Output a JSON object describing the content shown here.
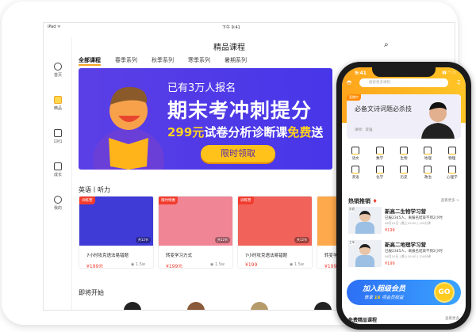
{
  "ipad": {
    "status_left": "iPad ᯤ",
    "status_time": "下午 9:41",
    "title": "精品课程",
    "sidebar": [
      {
        "label": "首页",
        "icon": "home-icon"
      },
      {
        "label": "精品",
        "icon": "diamond-icon"
      },
      {
        "label": "1对1",
        "icon": "one-on-one-icon"
      },
      {
        "label": "成长",
        "icon": "layers-icon"
      },
      {
        "label": "我的",
        "icon": "user-icon"
      }
    ],
    "tabs": [
      "全部课程",
      "春季系列",
      "秋季系列",
      "寒季系列",
      "暑期系列"
    ],
    "banner": {
      "line1": "已有3万人报名",
      "headline": "期末考冲刺提分",
      "sub_price": "299元",
      "sub_mid": "试卷分析诊断课",
      "sub_free": "免费",
      "sub_end": "送",
      "button": "限时领取"
    },
    "section1": "英语丨听力",
    "cards": [
      {
        "tag": "训练营",
        "count": "共12节",
        "title": "7小时攻克语法易错题",
        "price": "¥199元",
        "views": "1.5w",
        "color": "#3f3bd6"
      },
      {
        "tag": "限时特惠",
        "count": "共12节",
        "title": "转变学习方式",
        "price": "¥199元",
        "views": "1.5w",
        "color": "#f08595"
      },
      {
        "tag": "训练营",
        "count": "共12节",
        "title": "7小时攻克语法易错题",
        "price": "¥199",
        "views": "1.5w",
        "color": "#f0625a"
      },
      {
        "tag": "",
        "count": "",
        "title": "转变学习方式",
        "price": "¥199元",
        "views": "",
        "color": "#ffa94d"
      }
    ],
    "section2": "即将开始"
  },
  "phone": {
    "time": "9:41",
    "search_placeholder": "搜索更多课程",
    "banner": {
      "tag": "直播中",
      "title": "必备文诗词题必杀技",
      "teacher": "讲师：李强"
    },
    "subjects": [
      "语文",
      "数学",
      "生物",
      "地理",
      "物理",
      "英语",
      "化学",
      "历史",
      "政治",
      "心理学"
    ],
    "hot_title": "热销推销",
    "more": "查看更多 >",
    "hot": [
      {
        "badge": "张君",
        "title": "新高二生物学习营",
        "sub": "已报2345人，离报名结束不到2小时",
        "date": "06月10日 | 晚上10:00 | 120分钟",
        "price": "¥199"
      },
      {
        "badge": "王萍",
        "title": "新高二地理学习营",
        "sub": "已报2345人，离报名结束不到2小时",
        "date": "06月10日 | 晚上10:00 | 120分钟",
        "price": "¥199"
      }
    ],
    "vip": {
      "line1": "加入超级会员",
      "line2_pre": "尊享",
      "line2_num": "16",
      "line2_post": "项会员权益",
      "go": "GO"
    },
    "bottom_title": "免费精品课程",
    "bottom_more": "查看更多"
  },
  "colors": {
    "accent": "#ffc21a",
    "banner": "#5b3fe6",
    "price": "#f23c2e"
  }
}
